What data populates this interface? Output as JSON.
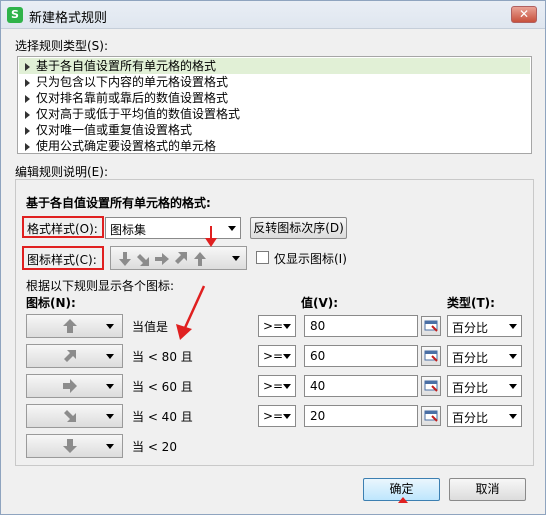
{
  "window": {
    "title": "新建格式规则",
    "app_icon": "S",
    "close_glyph": "✕"
  },
  "rule_type": {
    "label": "选择规则类型(S):",
    "items": [
      "基于各自值设置所有单元格的格式",
      "只为包含以下内容的单元格设置格式",
      "仅对排名靠前或靠后的数值设置格式",
      "仅对高于或低于平均值的数值设置格式",
      "仅对唯一值或重复值设置格式",
      "使用公式确定要设置格式的单元格"
    ],
    "selected_index": 0
  },
  "edit": {
    "label": "编辑规则说明(E):",
    "heading": "基于各自值设置所有单元格的格式:",
    "format_style_label": "格式样式(O):",
    "format_style_value": "图标集",
    "reverse_button": "反转图标次序(D)",
    "icon_style_label": "图标样式(C):",
    "icon_style_icons": "five-gray-arrows",
    "show_icon_only_label": "仅显示图标(I)",
    "show_icon_only_checked": false,
    "rules_caption": "根据以下规则显示各个图标:",
    "col_icon": "图标(N):",
    "col_value": "值(V):",
    "col_type": "类型(T):",
    "rows": [
      {
        "icon": "arrow-up-icon",
        "condition": "当值是",
        "operator": ">=",
        "value": "80",
        "type": "百分比"
      },
      {
        "icon": "arrow-up-right-icon",
        "condition": "当 < 80 且",
        "operator": ">=",
        "value": "60",
        "type": "百分比"
      },
      {
        "icon": "arrow-right-icon",
        "condition": "当 < 60 且",
        "operator": ">=",
        "value": "40",
        "type": "百分比"
      },
      {
        "icon": "arrow-down-right-icon",
        "condition": "当 < 40 且",
        "operator": ">=",
        "value": "20",
        "type": "百分比"
      },
      {
        "icon": "arrow-down-icon",
        "condition": "当 < 20"
      }
    ]
  },
  "footer": {
    "ok": "确定",
    "cancel": "取消"
  },
  "colors": {
    "accent_red": "#e02020",
    "selection_green": "#e1f0d6",
    "icon_gray": "#8c8c8c"
  }
}
